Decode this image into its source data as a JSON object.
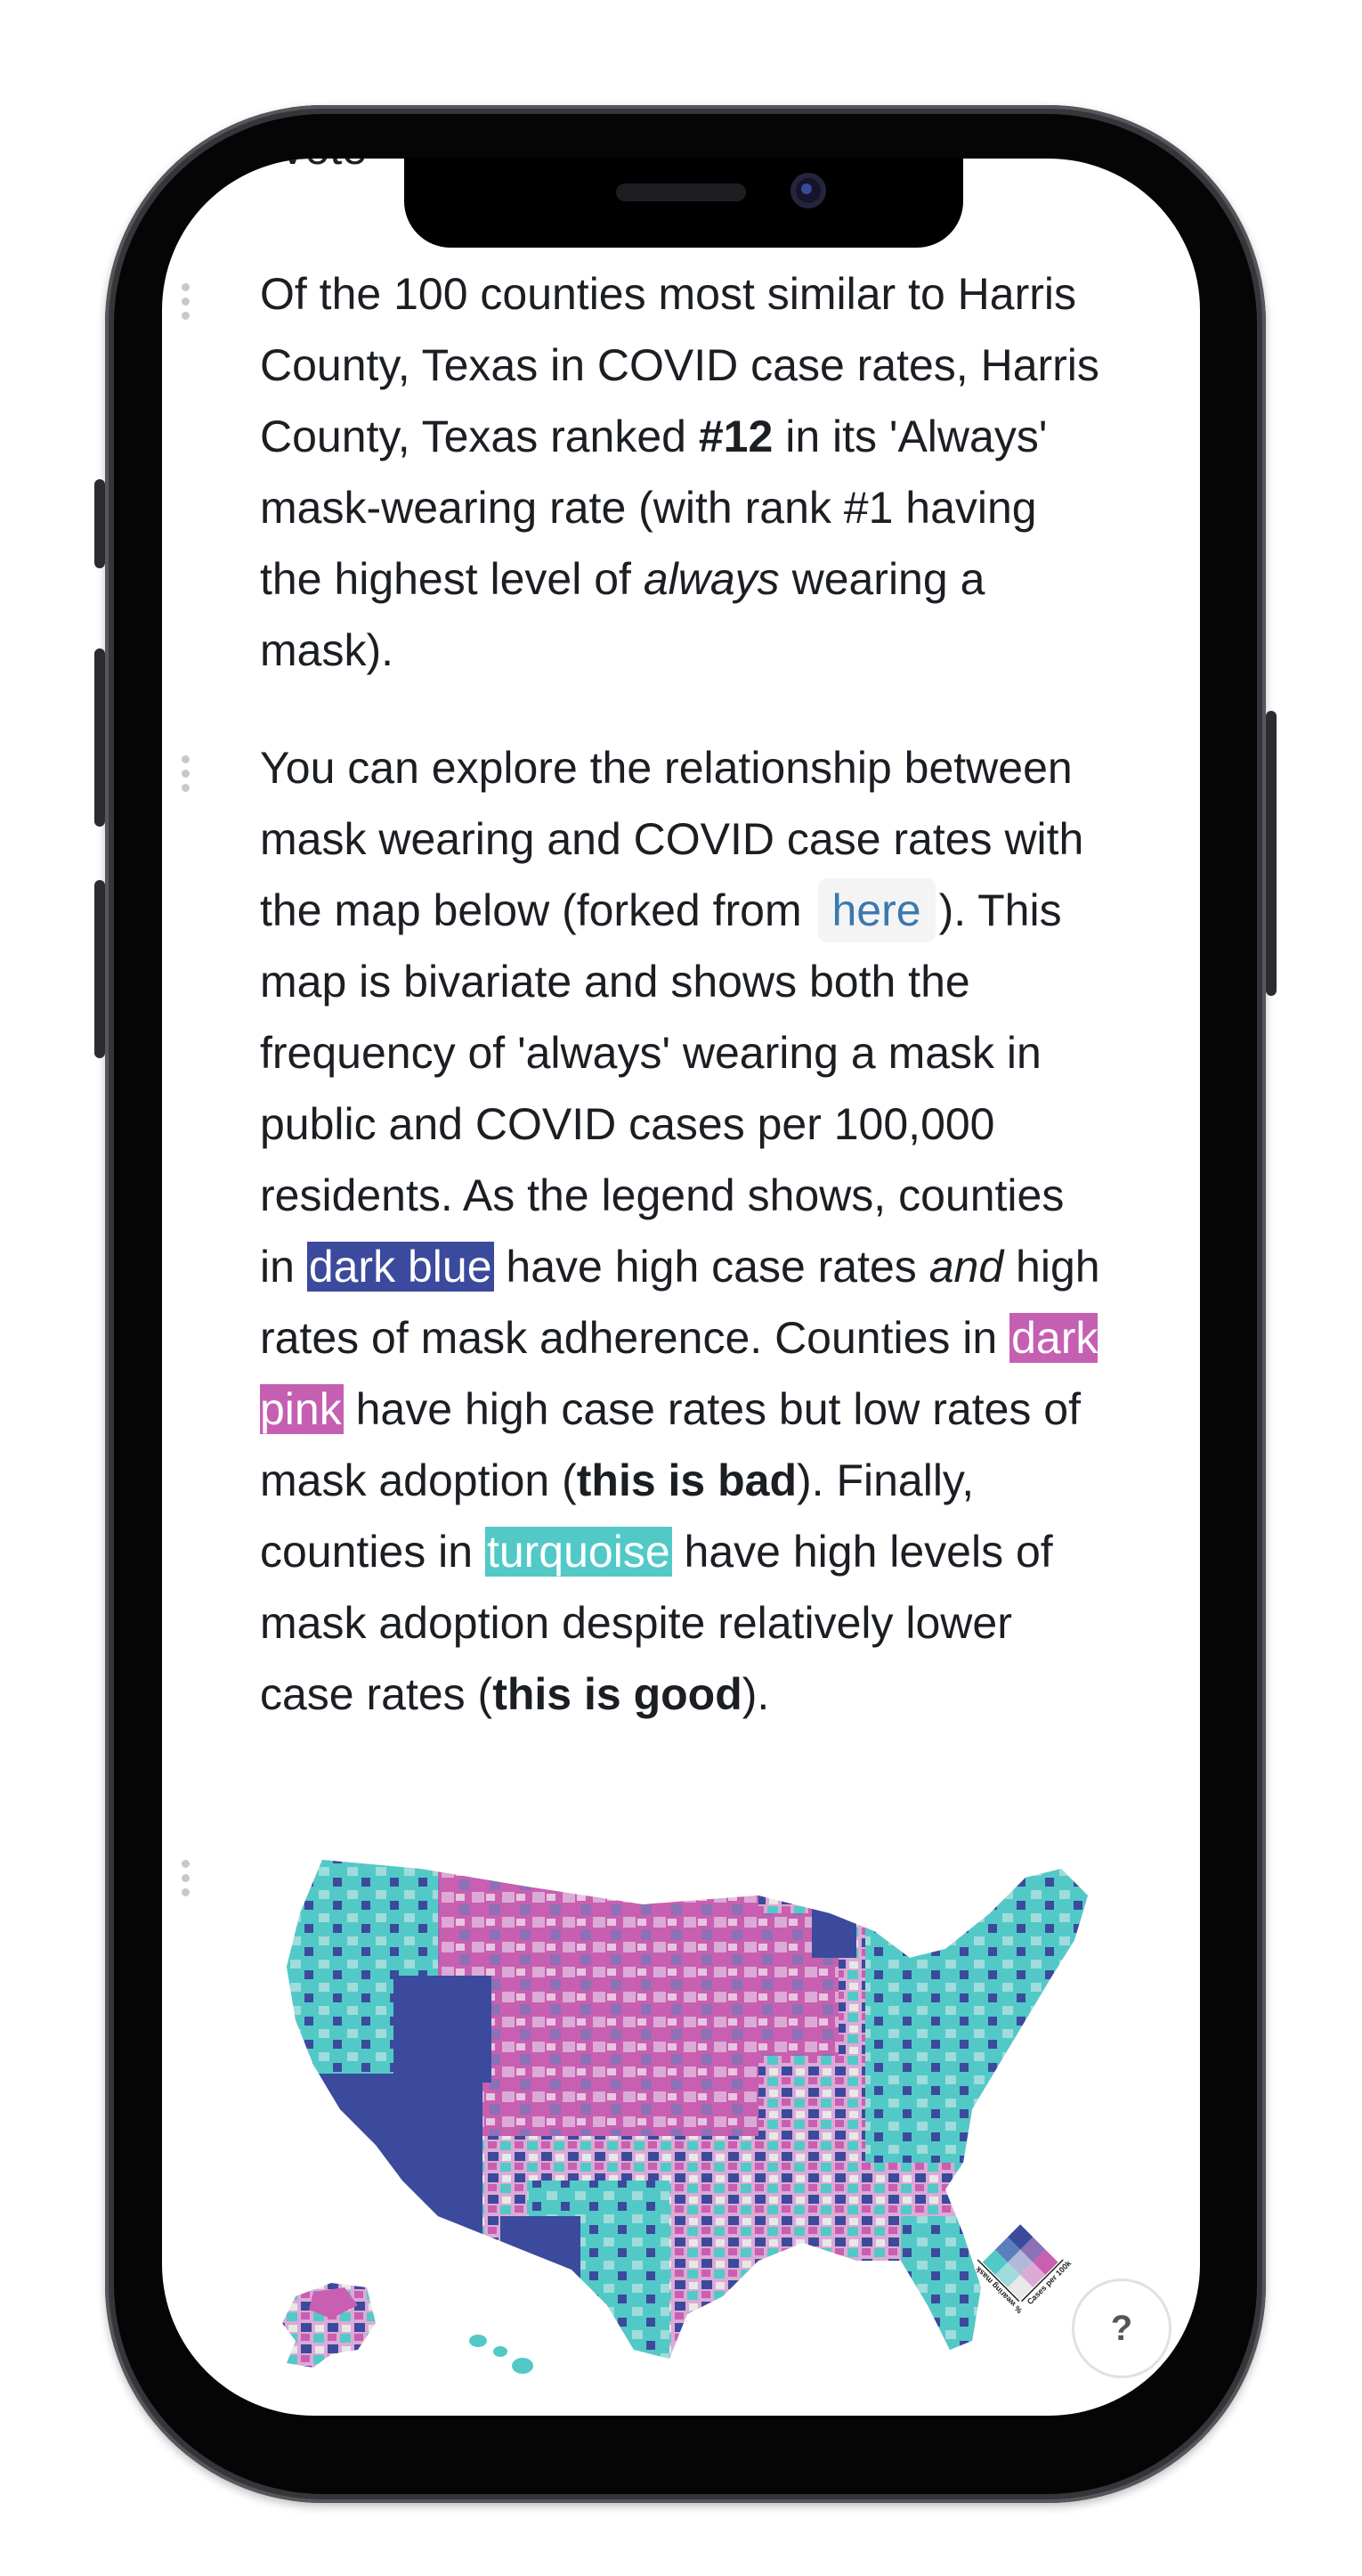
{
  "top_cutoff_text": "Vote",
  "para1": {
    "t1": "Of the 100 counties most similar to Harris County, Texas in COVID case rates, Harris County, Texas ranked ",
    "rank": "#12",
    "t2": " in its 'Always' mask-wearing rate (with rank #1 having the highest level of ",
    "em": "always",
    "t3": " wearing a mask)."
  },
  "para2": {
    "t1": "You can explore the relationship between mask wearing and COVID case rates with the map below (forked from ",
    "link": "here",
    "t2": "). This map is bivariate and shows both the frequency of 'always' wearing a mask in public and COVID cases per 100,000 residents. As the legend shows, counties in ",
    "dark_blue": "dark blue",
    "t3": " have high case rates ",
    "and": "and",
    "t4": " high rates of mask adherence. Counties in ",
    "dark_pink": "dark pink",
    "t5": " have high case rates but low rates of mask adoption (",
    "bad": "this is bad",
    "t6": "). Finally, counties in ",
    "turquoise": "turquoise",
    "t7": " have high levels of mask adoption despite relatively lower case rates (",
    "good": "this is good",
    "t8": ")."
  },
  "map": {
    "legend_x_label": "Cases per 100k",
    "legend_y_label": "% wearing mask",
    "colors": {
      "dark_blue": "#3b4a9c",
      "dark_pink": "#c95fb0",
      "turquoise": "#52c9c7",
      "light_pink": "#dcaad6",
      "light_teal": "#9fdcdb",
      "mid_purple": "#8c71b6",
      "light_gray": "#e8e8e8"
    }
  },
  "help_button": "?",
  "highlight_colors": {
    "dark_blue": "#3b4a9c",
    "dark_pink": "#c55fb2",
    "turquoise": "#52c9c7"
  }
}
